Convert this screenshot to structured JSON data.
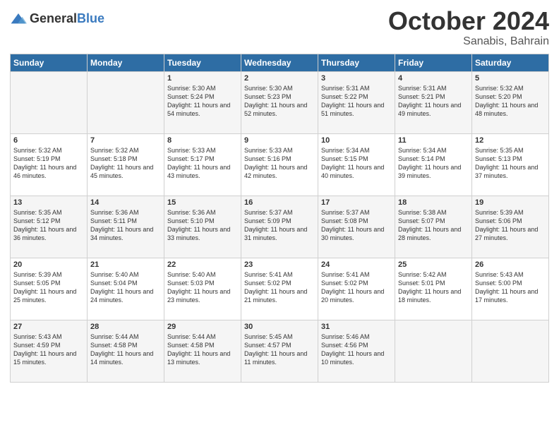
{
  "header": {
    "logo_general": "General",
    "logo_blue": "Blue",
    "month": "October 2024",
    "location": "Sanabis, Bahrain"
  },
  "columns": [
    "Sunday",
    "Monday",
    "Tuesday",
    "Wednesday",
    "Thursday",
    "Friday",
    "Saturday"
  ],
  "weeks": [
    [
      {
        "day": "",
        "info": ""
      },
      {
        "day": "",
        "info": ""
      },
      {
        "day": "1",
        "info": "Sunrise: 5:30 AM\nSunset: 5:24 PM\nDaylight: 11 hours and 54 minutes."
      },
      {
        "day": "2",
        "info": "Sunrise: 5:30 AM\nSunset: 5:23 PM\nDaylight: 11 hours and 52 minutes."
      },
      {
        "day": "3",
        "info": "Sunrise: 5:31 AM\nSunset: 5:22 PM\nDaylight: 11 hours and 51 minutes."
      },
      {
        "day": "4",
        "info": "Sunrise: 5:31 AM\nSunset: 5:21 PM\nDaylight: 11 hours and 49 minutes."
      },
      {
        "day": "5",
        "info": "Sunrise: 5:32 AM\nSunset: 5:20 PM\nDaylight: 11 hours and 48 minutes."
      }
    ],
    [
      {
        "day": "6",
        "info": "Sunrise: 5:32 AM\nSunset: 5:19 PM\nDaylight: 11 hours and 46 minutes."
      },
      {
        "day": "7",
        "info": "Sunrise: 5:32 AM\nSunset: 5:18 PM\nDaylight: 11 hours and 45 minutes."
      },
      {
        "day": "8",
        "info": "Sunrise: 5:33 AM\nSunset: 5:17 PM\nDaylight: 11 hours and 43 minutes."
      },
      {
        "day": "9",
        "info": "Sunrise: 5:33 AM\nSunset: 5:16 PM\nDaylight: 11 hours and 42 minutes."
      },
      {
        "day": "10",
        "info": "Sunrise: 5:34 AM\nSunset: 5:15 PM\nDaylight: 11 hours and 40 minutes."
      },
      {
        "day": "11",
        "info": "Sunrise: 5:34 AM\nSunset: 5:14 PM\nDaylight: 11 hours and 39 minutes."
      },
      {
        "day": "12",
        "info": "Sunrise: 5:35 AM\nSunset: 5:13 PM\nDaylight: 11 hours and 37 minutes."
      }
    ],
    [
      {
        "day": "13",
        "info": "Sunrise: 5:35 AM\nSunset: 5:12 PM\nDaylight: 11 hours and 36 minutes."
      },
      {
        "day": "14",
        "info": "Sunrise: 5:36 AM\nSunset: 5:11 PM\nDaylight: 11 hours and 34 minutes."
      },
      {
        "day": "15",
        "info": "Sunrise: 5:36 AM\nSunset: 5:10 PM\nDaylight: 11 hours and 33 minutes."
      },
      {
        "day": "16",
        "info": "Sunrise: 5:37 AM\nSunset: 5:09 PM\nDaylight: 11 hours and 31 minutes."
      },
      {
        "day": "17",
        "info": "Sunrise: 5:37 AM\nSunset: 5:08 PM\nDaylight: 11 hours and 30 minutes."
      },
      {
        "day": "18",
        "info": "Sunrise: 5:38 AM\nSunset: 5:07 PM\nDaylight: 11 hours and 28 minutes."
      },
      {
        "day": "19",
        "info": "Sunrise: 5:39 AM\nSunset: 5:06 PM\nDaylight: 11 hours and 27 minutes."
      }
    ],
    [
      {
        "day": "20",
        "info": "Sunrise: 5:39 AM\nSunset: 5:05 PM\nDaylight: 11 hours and 25 minutes."
      },
      {
        "day": "21",
        "info": "Sunrise: 5:40 AM\nSunset: 5:04 PM\nDaylight: 11 hours and 24 minutes."
      },
      {
        "day": "22",
        "info": "Sunrise: 5:40 AM\nSunset: 5:03 PM\nDaylight: 11 hours and 23 minutes."
      },
      {
        "day": "23",
        "info": "Sunrise: 5:41 AM\nSunset: 5:02 PM\nDaylight: 11 hours and 21 minutes."
      },
      {
        "day": "24",
        "info": "Sunrise: 5:41 AM\nSunset: 5:02 PM\nDaylight: 11 hours and 20 minutes."
      },
      {
        "day": "25",
        "info": "Sunrise: 5:42 AM\nSunset: 5:01 PM\nDaylight: 11 hours and 18 minutes."
      },
      {
        "day": "26",
        "info": "Sunrise: 5:43 AM\nSunset: 5:00 PM\nDaylight: 11 hours and 17 minutes."
      }
    ],
    [
      {
        "day": "27",
        "info": "Sunrise: 5:43 AM\nSunset: 4:59 PM\nDaylight: 11 hours and 15 minutes."
      },
      {
        "day": "28",
        "info": "Sunrise: 5:44 AM\nSunset: 4:58 PM\nDaylight: 11 hours and 14 minutes."
      },
      {
        "day": "29",
        "info": "Sunrise: 5:44 AM\nSunset: 4:58 PM\nDaylight: 11 hours and 13 minutes."
      },
      {
        "day": "30",
        "info": "Sunrise: 5:45 AM\nSunset: 4:57 PM\nDaylight: 11 hours and 11 minutes."
      },
      {
        "day": "31",
        "info": "Sunrise: 5:46 AM\nSunset: 4:56 PM\nDaylight: 11 hours and 10 minutes."
      },
      {
        "day": "",
        "info": ""
      },
      {
        "day": "",
        "info": ""
      }
    ]
  ]
}
